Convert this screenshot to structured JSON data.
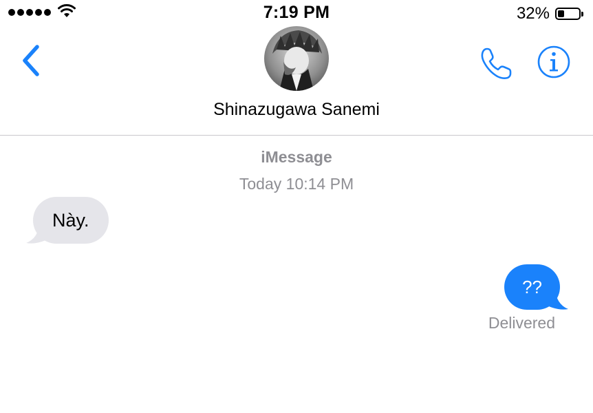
{
  "status_bar": {
    "time": "7:19 PM",
    "battery_percent": "32%",
    "battery_level": 0.32,
    "signal_bars": 5,
    "icons": [
      "signal-dots-icon",
      "wifi-icon",
      "battery-icon"
    ]
  },
  "header": {
    "contact_name": "Shinazugawa Sanemi",
    "icons": [
      "back-chevron-icon",
      "phone-icon",
      "info-icon"
    ],
    "accent_color": "#1a82fb"
  },
  "conversation": {
    "service_label": "iMessage",
    "timestamp": "Today 10:14 PM",
    "messages": [
      {
        "direction": "incoming",
        "text": "Này."
      },
      {
        "direction": "outgoing",
        "text": "??",
        "status": "Delivered"
      }
    ]
  },
  "colors": {
    "incoming_bubble": "#e5e5ea",
    "outgoing_bubble": "#1a82fb",
    "secondary_text": "#8e8e93"
  }
}
